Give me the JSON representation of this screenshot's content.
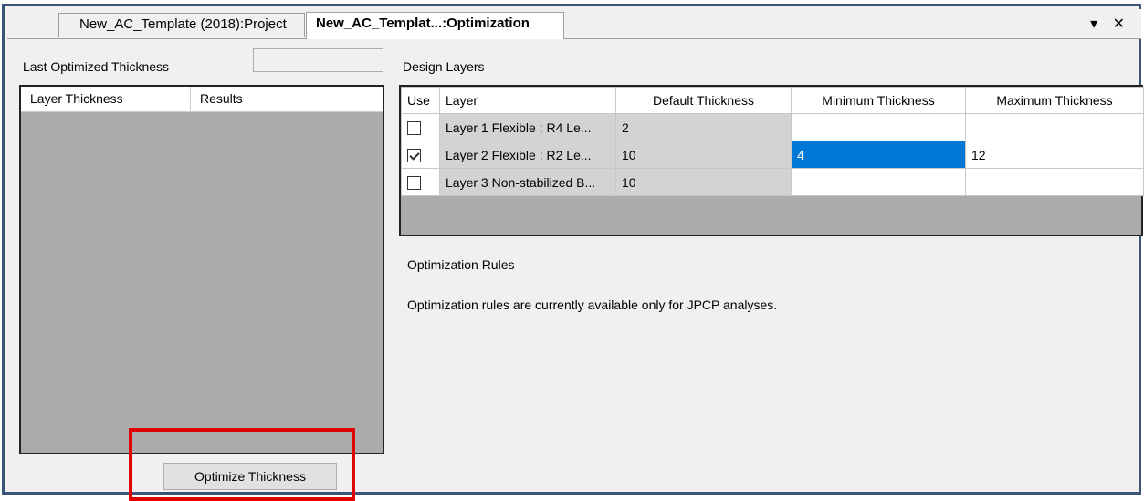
{
  "tabs": {
    "project_label": "New_AC_Template (2018):Project",
    "optimization_label": "New_AC_Templat...:Optimization",
    "controls": "▾ ✕"
  },
  "left": {
    "last_optimized_label": "Last Optimized Thickness",
    "last_optimized_value": "",
    "results_headers": [
      "Layer Thickness",
      "Results"
    ],
    "optimize_button": "Optimize Thickness"
  },
  "design": {
    "title": "Design Layers",
    "headers": [
      "Use",
      "Layer",
      "Default Thickness",
      "Minimum Thickness",
      "Maximum Thickness"
    ],
    "rows": [
      {
        "use": false,
        "layer": "Layer 1 Flexible : R4 Le...",
        "default": "2",
        "min": "",
        "max": ""
      },
      {
        "use": true,
        "layer": "Layer 2 Flexible : R2 Le...",
        "default": "10",
        "min": "4",
        "max": "12"
      },
      {
        "use": false,
        "layer": "Layer 3 Non-stabilized B...",
        "default": "10",
        "min": "",
        "max": ""
      }
    ]
  },
  "rules": {
    "title": "Optimization Rules",
    "message": "Optimization rules are currently available only for JPCP analyses."
  },
  "colors": {
    "frame": "#3b5279",
    "selection": "#0078d7",
    "highlight_box": "#e00000",
    "grid_empty": "#ababab"
  }
}
